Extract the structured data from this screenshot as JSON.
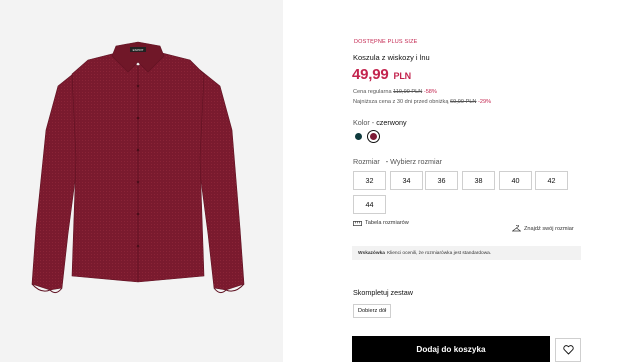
{
  "product": {
    "badge": "DOSTĘPNE PLUS SIZE",
    "title": "Koszula z wiskozy i lnu",
    "price_value": "49,99",
    "price_currency": "PLN",
    "regular_label": "Cena regularna",
    "regular_old": "119,99 PLN",
    "regular_discount": "-58%",
    "lowest_label": "Najniższa cena z 30 dni przed obniżką",
    "lowest_old": "69,99 PLN",
    "lowest_discount": "-29%"
  },
  "color": {
    "label": "Kolor",
    "separator": "-",
    "selected": "czerwony",
    "swatches": [
      {
        "name": "dark-teal",
        "hex": "#0f3a3d"
      },
      {
        "name": "czerwony",
        "hex": "#7d1a35",
        "selected": true
      }
    ]
  },
  "size": {
    "label": "Rozmiar",
    "separator": "-",
    "prompt": "Wybierz rozmiar",
    "options": [
      "32",
      "34",
      "36",
      "38",
      "40",
      "42",
      "44"
    ],
    "table_link": "Tabela rozmiarów",
    "find_link": "Znajdź swój rozmiar"
  },
  "hint": {
    "title": "Wskazówka",
    "text": "Klienci ocenili, że rozmiarówka jest standardowa."
  },
  "set": {
    "label": "Skompletuj zestaw",
    "button": "Dobierz dół"
  },
  "cart": {
    "button": "Dodaj do koszyka"
  },
  "gallery": {
    "brand_tag": "ESPRIT"
  },
  "colors": {
    "accent": "#c3244e",
    "shirt": "#7a1a2e",
    "background": "#f3f3f3",
    "button": "#000000"
  }
}
